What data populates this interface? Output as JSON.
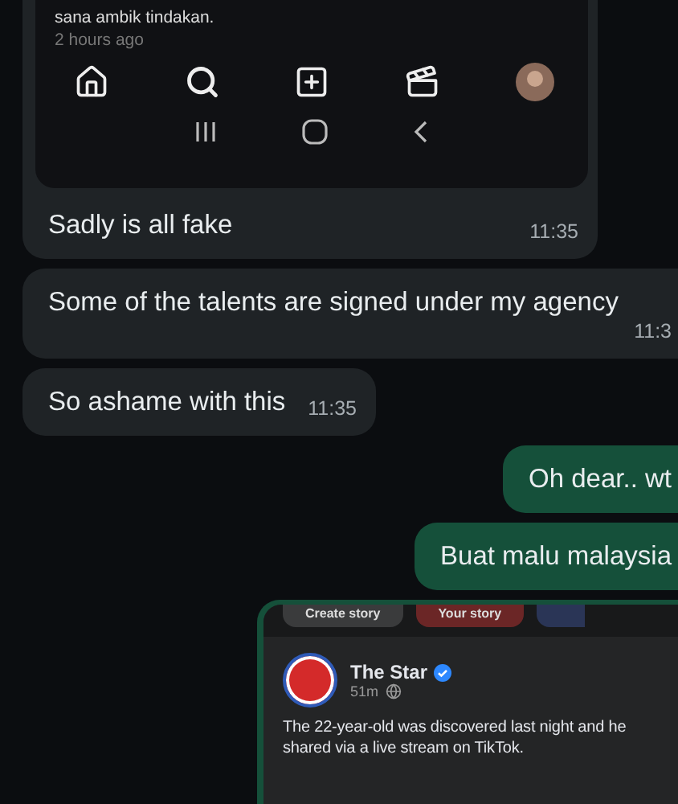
{
  "messages": [
    {
      "kind": "image",
      "outgoing": false,
      "image_lines": [
        "sana ambik tindakan.",
        "2 hours ago"
      ],
      "text": "Sadly is all fake",
      "time": "11:35"
    },
    {
      "kind": "text",
      "outgoing": false,
      "text": "Some of the talents are signed under my agency",
      "time": "11:3"
    },
    {
      "kind": "text",
      "outgoing": false,
      "text": "So ashame with this",
      "time": "11:35"
    },
    {
      "kind": "text",
      "outgoing": true,
      "text": "Oh dear.. wt"
    },
    {
      "kind": "text",
      "outgoing": true,
      "text": "Buat malu malaysia"
    },
    {
      "kind": "post",
      "outgoing": true,
      "stories": [
        "Create story",
        "Your story"
      ],
      "author": "The Star",
      "age": "51m",
      "lines": [
        "The 22-year-old was discovered last night and he",
        "shared via a live stream on TikTok."
      ]
    }
  ]
}
